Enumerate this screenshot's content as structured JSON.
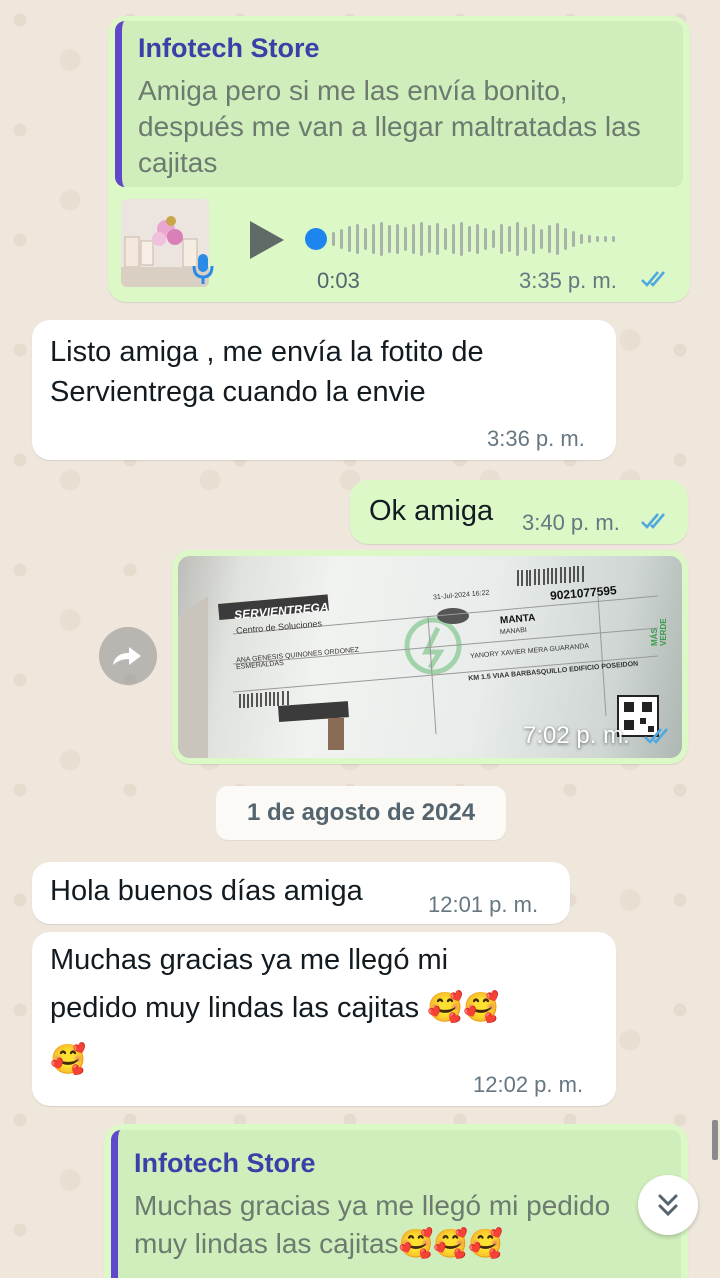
{
  "colors": {
    "outgoing_bubble": "#dcf8c6",
    "incoming_bubble": "#ffffff",
    "quote_accent": "#5f48c9",
    "read_ticks": "#4fa8e0",
    "voice_progress": "#1c86ee"
  },
  "messages": [
    {
      "direction": "outgoing",
      "type": "voice-reply",
      "quote": {
        "author": "Infotech Store",
        "text": "Amiga pero si me las envía bonito, después me van a llegar maltratadas las cajitas"
      },
      "voice": {
        "duration": "0:03",
        "icon": "mic-icon",
        "progress": 0
      },
      "time": "3:35 p. m.",
      "status": "read"
    },
    {
      "direction": "incoming",
      "type": "text",
      "text": "Listo amiga , me envía la fotito de Servientrega cuando la envie",
      "time": "3:36 p. m."
    },
    {
      "direction": "outgoing",
      "type": "text",
      "text": "Ok amiga",
      "time": "3:40 p. m.",
      "status": "read"
    },
    {
      "direction": "outgoing",
      "type": "image",
      "image_text": {
        "brand": "SERVIENTREGA",
        "tagline": "Centro de Soluciones",
        "guide_number": "9021077595",
        "destination": "MANTA",
        "province": "MANABI",
        "recipient": "YANORY XAVIER MERA GUARANDA",
        "address": "KM 1.5 VIAA BARBASQUILLO EDIFICIO POSEIDON",
        "sender": "ANA GENESIS QUINONES ORDONEZ",
        "city": "ESMERALDAS",
        "date": "31-Jul-2024 16:22",
        "stamp": "MÁS VERDE"
      },
      "time": "7:02 p. m.",
      "status": "read"
    },
    {
      "direction": "incoming",
      "type": "text",
      "text": "Hola buenos días amiga",
      "time": "12:01 p. m."
    },
    {
      "direction": "incoming",
      "type": "text",
      "text_line1": "Muchas gracias ya me llegó mi",
      "text_line2": "pedido muy lindas las cajitas",
      "emoji_line2": "🥰🥰",
      "emoji_line3": "🥰",
      "time": "12:02 p. m."
    },
    {
      "direction": "outgoing",
      "type": "reply",
      "quote": {
        "author": "Infotech Store",
        "text_line1": "Muchas gracias ya me llegó mi pedido",
        "text_line2": "muy lindas las cajitas",
        "emoji": "🥰🥰🥰"
      }
    }
  ],
  "date_divider": "1 de agosto de 2024",
  "icons": {
    "forward": "forward-icon",
    "scroll_down": "chevron-double-down-icon",
    "play": "play-icon"
  }
}
